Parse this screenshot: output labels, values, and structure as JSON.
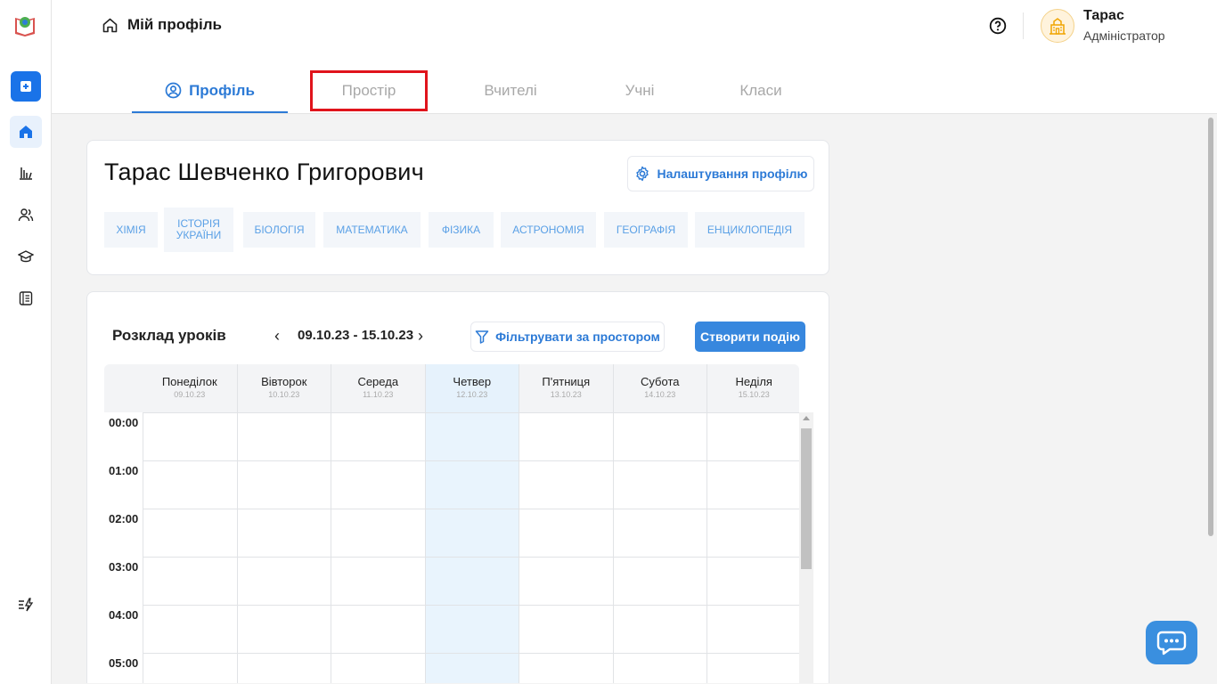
{
  "sidebar": {
    "items": [
      {
        "icon": "plus-square-icon"
      },
      {
        "icon": "home-icon"
      },
      {
        "icon": "bar-chart-icon"
      },
      {
        "icon": "users-icon"
      },
      {
        "icon": "graduation-cap-icon"
      },
      {
        "icon": "notebook-icon"
      },
      {
        "icon": "lightning-list-icon"
      }
    ]
  },
  "header": {
    "breadcrumb": "Мій профіль",
    "user_name": "Тарас",
    "user_role": "Адміністратор",
    "tabs": [
      {
        "label": "Профіль",
        "active": true
      },
      {
        "label": "Простір"
      },
      {
        "label": "Вчителі"
      },
      {
        "label": "Учні"
      },
      {
        "label": "Класи"
      }
    ]
  },
  "profile": {
    "full_name": "Тарас Шевченко Григорович",
    "settings_label": "Налаштування профілю",
    "subjects": [
      "ХІМІЯ",
      "ІСТОРІЯ УКРАЇНИ",
      "БІОЛОГІЯ",
      "МАТЕМАТИКА",
      "ФІЗИКА",
      "АСТРОНОМІЯ",
      "ГЕОГРАФІЯ",
      "ЕНЦИКЛОПЕДІЯ"
    ]
  },
  "schedule": {
    "title": "Розклад уроків",
    "prev_symbol": "‹",
    "next_symbol": "›",
    "date_range": "09.10.23 - 15.10.23",
    "filter_label": "Фільтрувати за простором",
    "create_label": "Створити подію",
    "days": [
      {
        "name": "Понеділок",
        "date": "09.10.23"
      },
      {
        "name": "Вівторок",
        "date": "10.10.23"
      },
      {
        "name": "Середа",
        "date": "11.10.23"
      },
      {
        "name": "Четвер",
        "date": "12.10.23",
        "today": true
      },
      {
        "name": "П'ятниця",
        "date": "13.10.23"
      },
      {
        "name": "Субота",
        "date": "14.10.23"
      },
      {
        "name": "Неділя",
        "date": "15.10.23"
      }
    ],
    "hours": [
      "00:00",
      "01:00",
      "02:00",
      "03:00",
      "04:00",
      "05:00"
    ]
  },
  "colors": {
    "accent": "#2c7ad6",
    "primary_button": "#3787de",
    "highlight_box": "#e0141c",
    "today_column": "#e9f4fd"
  }
}
